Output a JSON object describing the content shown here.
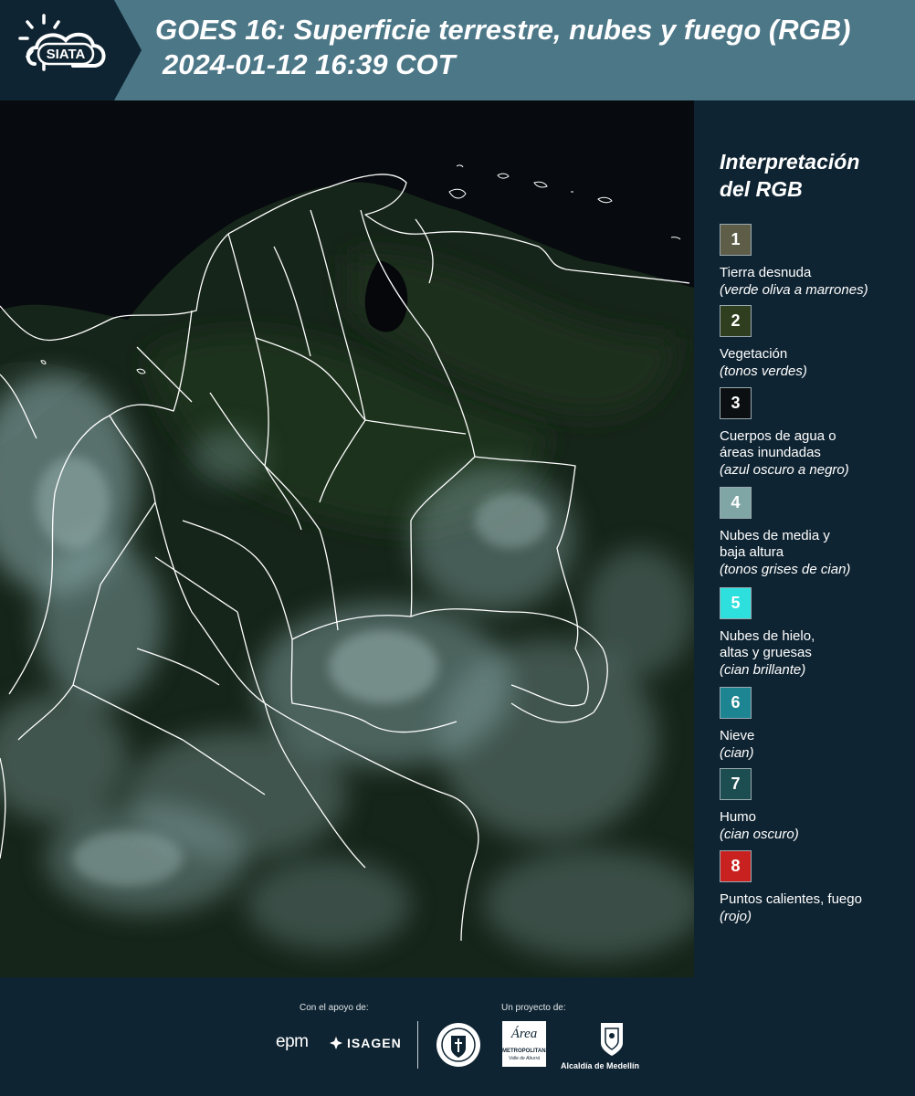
{
  "header": {
    "logo_text": "SIATA",
    "title_line1": "GOES 16: Superficie terrestre, nubes y fuego (RGB)",
    "title_line2": "2024-01-12 16:39 COT"
  },
  "legend": {
    "title_line1": "Interpretación",
    "title_line2": "del RGB",
    "items": [
      {
        "number": "1",
        "color": "#5e5e48",
        "label": "Tierra desnuda",
        "desc": "(verde oliva a marrones)"
      },
      {
        "number": "2",
        "color": "#2e3e1f",
        "label": "Vegetación",
        "desc": "(tonos verdes)"
      },
      {
        "number": "3",
        "color": "#0c0f12",
        "label": "Cuerpos de agua o áreas inundadas",
        "desc": "(azul oscuro a negro)"
      },
      {
        "number": "4",
        "color": "#7fa6a5",
        "label": "Nubes de media y baja altura",
        "desc": "(tonos grises de cian)"
      },
      {
        "number": "5",
        "color": "#2de0de",
        "label": "Nubes de hielo, altas y gruesas",
        "desc": "(cian brillante)"
      },
      {
        "number": "6",
        "color": "#1d8592",
        "label": "Nieve",
        "desc": "(cian)"
      },
      {
        "number": "7",
        "color": "#1c4d50",
        "label": "Humo",
        "desc": "(cian oscuro)"
      },
      {
        "number": "8",
        "color": "#c9211f",
        "label": "Puntos calientes, fuego",
        "desc": "(rojo)"
      }
    ]
  },
  "footer": {
    "support_caption": "Con el apoyo de:",
    "project_caption": "Un proyecto de:",
    "epm_text": "epm",
    "isagen_text": "ISAGEN",
    "amva_line1": "Área",
    "amva_line2": "METROPOLITANA",
    "amva_line3": "Valle de Aburrá",
    "medellin_text": "Alcaldía de Medellín"
  },
  "colors": {
    "header_bg": "#4c7787",
    "page_bg": "#0f2432",
    "map_land": "#1a2a20",
    "map_water": "#07090d",
    "cloud": "#8fb0b2"
  },
  "icons": [
    "sun-icon",
    "cloud-icon",
    "escudo-icon",
    "emblem-icon"
  ]
}
